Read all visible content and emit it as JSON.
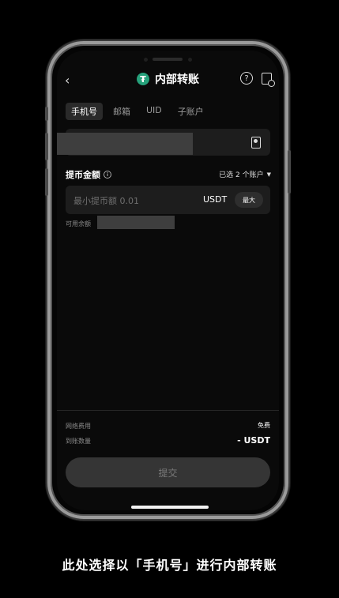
{
  "header": {
    "back_icon": "chevron-left-icon",
    "title": "内部转账",
    "coin_icon_glyph": "₮",
    "coin_icon_color": "#26a17b",
    "help_icon": "question-circle-icon",
    "history_icon": "record-clock-icon"
  },
  "tabs": [
    {
      "label": "手机号",
      "active": true
    },
    {
      "label": "邮箱",
      "active": false
    },
    {
      "label": "UID",
      "active": false
    },
    {
      "label": "子账户",
      "active": false
    }
  ],
  "recipient": {
    "contact_icon": "contact-book-icon"
  },
  "amount": {
    "label": "提币金额",
    "info_icon": "info-icon",
    "accounts_selected": "已选 2 个账户",
    "placeholder": "最小提币额 0.01",
    "unit": "USDT",
    "max_label": "最大",
    "available_label": "可用余额"
  },
  "summary": {
    "fee_label": "网络费用",
    "fee_value": "免费",
    "receive_label": "到账数量",
    "receive_value": "- USDT"
  },
  "submit_label": "提交",
  "caption": "此处选择以「手机号」进行内部转账",
  "colors": {
    "background": "#000000",
    "screen": "#0a0a0a",
    "field": "#1d1d1d",
    "accent": "#26a17b"
  }
}
